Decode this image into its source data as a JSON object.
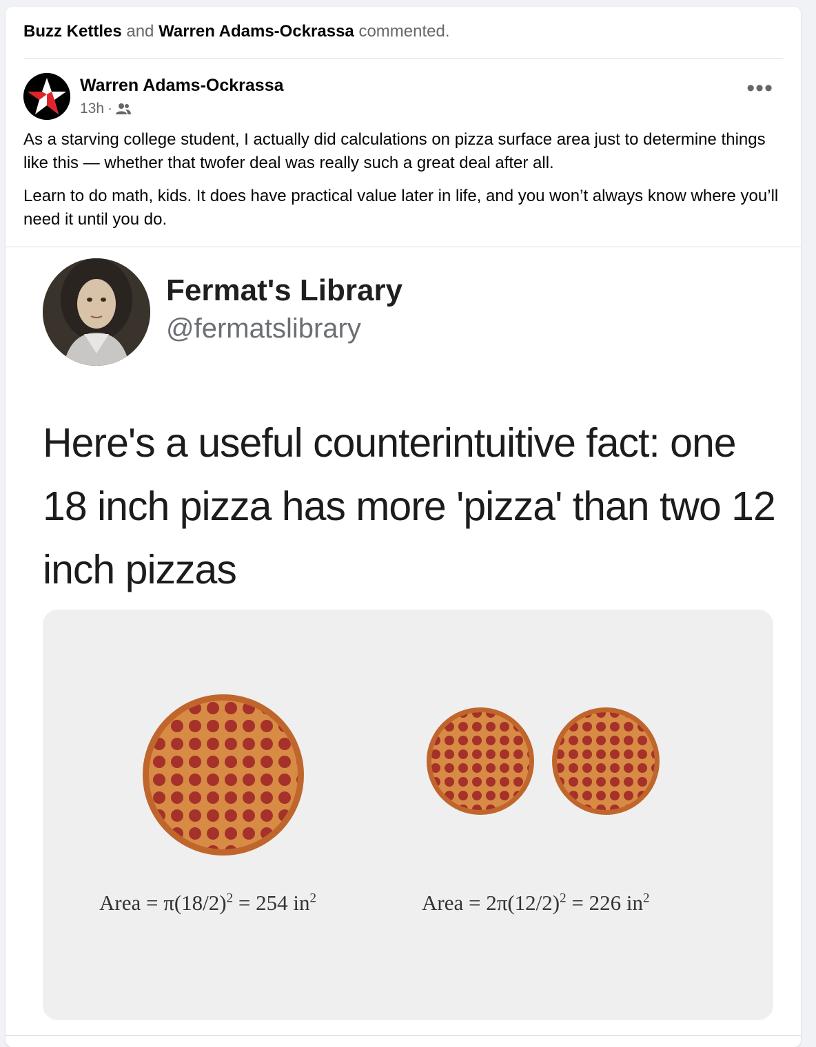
{
  "activity": {
    "user1": "Buzz Kettles",
    "conj": "and",
    "user2": "Warren Adams-Ockrassa",
    "verb": "commented."
  },
  "post": {
    "author": "Warren Adams-Ockrassa",
    "time": "13h",
    "dot": "·",
    "audience_icon": "friends-icon",
    "more_label": "•••",
    "paragraph1": "As a starving college student, I actually did calculations on pizza surface area just to determine things like this — whether that twofer deal was really such a great deal after all.",
    "paragraph2": "Learn to do math, kids. It does have practical value later in life, and you won’t always know where you’ll need it until you do."
  },
  "tweet": {
    "name": "Fermat's Library",
    "handle": "@fermatslibrary",
    "text": "Here's a useful counterintuitive fact: one 18 inch pizza has more 'pizza' than two 12 inch pizzas",
    "formula_left": {
      "prefix": "Area = π(18/2)",
      "exp": "2",
      "suffix": " = 254 in",
      "unit_exp": "2"
    },
    "formula_right": {
      "prefix": "Area = 2π(12/2)",
      "exp": "2",
      "suffix": " = 226 in",
      "unit_exp": "2"
    }
  },
  "colors": {
    "secondary_text": "#65676b",
    "pizza_crust": "#c0662c",
    "pepperoni": "#a5312a",
    "panel": "#efeff0"
  }
}
